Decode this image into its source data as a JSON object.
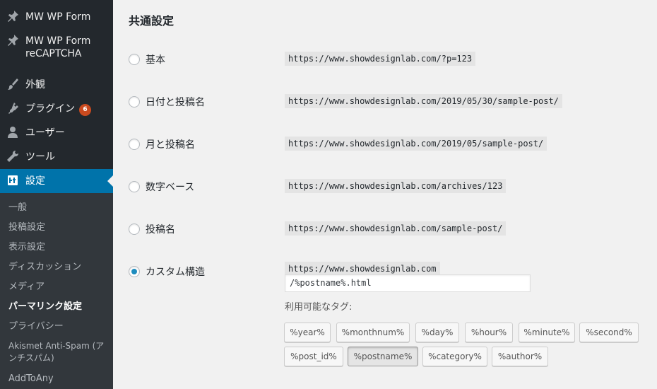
{
  "sidebar": {
    "items": [
      {
        "label": "MW WP Form",
        "icon": "pushpin-icon"
      },
      {
        "label": "MW WP Form reCAPTCHA",
        "icon": "pushpin-icon"
      },
      {
        "label": "外観",
        "icon": "paintbrush-icon"
      },
      {
        "label": "プラグイン",
        "icon": "plugin-icon",
        "badge": "6"
      },
      {
        "label": "ユーザー",
        "icon": "user-icon"
      },
      {
        "label": "ツール",
        "icon": "wrench-icon"
      },
      {
        "label": "設定",
        "icon": "settings-icon",
        "active": true
      }
    ],
    "submenu": [
      {
        "label": "一般"
      },
      {
        "label": "投稿設定"
      },
      {
        "label": "表示設定"
      },
      {
        "label": "ディスカッション"
      },
      {
        "label": "メディア"
      },
      {
        "label": "パーマリンク設定",
        "current": true
      },
      {
        "label": "プライバシー"
      },
      {
        "label": "Akismet Anti-Spam (アンチスパム)"
      },
      {
        "label": "AddToAny"
      }
    ],
    "colors": {
      "bg": "#23282d",
      "submenu_bg": "#32373c",
      "active": "#0073aa",
      "badge": "#ca4a1f"
    }
  },
  "main": {
    "section_title": "共通設定",
    "options": [
      {
        "label": "基本",
        "example": "https://www.showdesignlab.com/?p=123",
        "checked": false
      },
      {
        "label": "日付と投稿名",
        "example": "https://www.showdesignlab.com/2019/05/30/sample-post/",
        "checked": false
      },
      {
        "label": "月と投稿名",
        "example": "https://www.showdesignlab.com/2019/05/sample-post/",
        "checked": false
      },
      {
        "label": "数字ベース",
        "example": "https://www.showdesignlab.com/archives/123",
        "checked": false
      },
      {
        "label": "投稿名",
        "example": "https://www.showdesignlab.com/sample-post/",
        "checked": false
      },
      {
        "label": "カスタム構造",
        "example": "https://www.showdesignlab.com",
        "checked": true
      }
    ],
    "custom_structure_value": "/%postname%.html",
    "available_tags_label": "利用可能なタグ:",
    "tags": [
      "%year%",
      "%monthnum%",
      "%day%",
      "%hour%",
      "%minute%",
      "%second%",
      "%post_id%",
      "%postname%",
      "%category%",
      "%author%"
    ],
    "pressed_tag": "%postname%",
    "accent_color": "#1e8cbe"
  }
}
